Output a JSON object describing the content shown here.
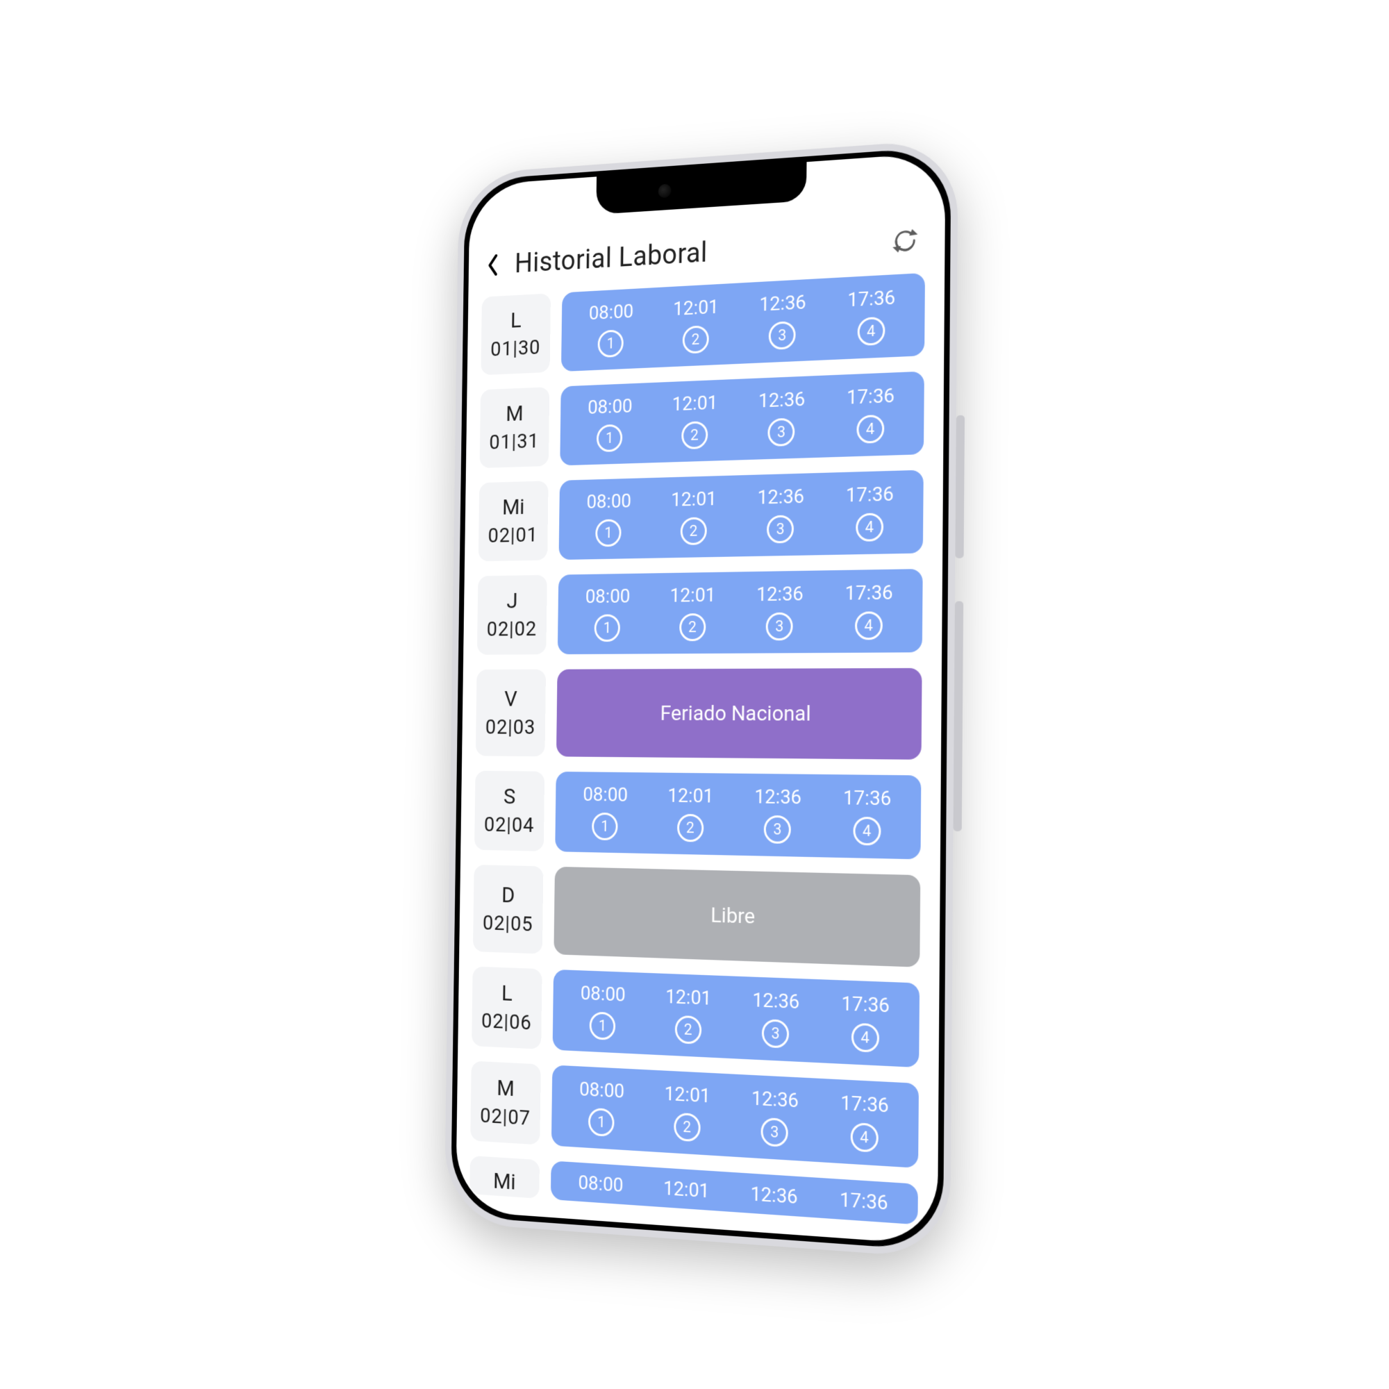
{
  "header": {
    "title": "Historial Laboral"
  },
  "days": [
    {
      "dow": "L",
      "date": "01|30",
      "type": "work",
      "punches": [
        "08:00",
        "12:01",
        "12:36",
        "17:36"
      ]
    },
    {
      "dow": "M",
      "date": "01|31",
      "type": "work",
      "punches": [
        "08:00",
        "12:01",
        "12:36",
        "17:36"
      ]
    },
    {
      "dow": "Mi",
      "date": "02|01",
      "type": "work",
      "punches": [
        "08:00",
        "12:01",
        "12:36",
        "17:36"
      ]
    },
    {
      "dow": "J",
      "date": "02|02",
      "type": "work",
      "punches": [
        "08:00",
        "12:01",
        "12:36",
        "17:36"
      ]
    },
    {
      "dow": "V",
      "date": "02|03",
      "type": "holiday",
      "label": "Feriado Nacional"
    },
    {
      "dow": "S",
      "date": "02|04",
      "type": "work",
      "punches": [
        "08:00",
        "12:01",
        "12:36",
        "17:36"
      ]
    },
    {
      "dow": "D",
      "date": "02|05",
      "type": "free",
      "label": "Libre"
    },
    {
      "dow": "L",
      "date": "02|06",
      "type": "work",
      "punches": [
        "08:00",
        "12:01",
        "12:36",
        "17:36"
      ]
    },
    {
      "dow": "M",
      "date": "02|07",
      "type": "work",
      "punches": [
        "08:00",
        "12:01",
        "12:36",
        "17:36"
      ]
    },
    {
      "dow": "Mi",
      "date": "",
      "type": "work",
      "punches": [
        "08:00",
        "12:01",
        "12:36",
        "17:36"
      ],
      "cut": true
    }
  ],
  "punch_indices": [
    "1",
    "2",
    "3",
    "4"
  ]
}
